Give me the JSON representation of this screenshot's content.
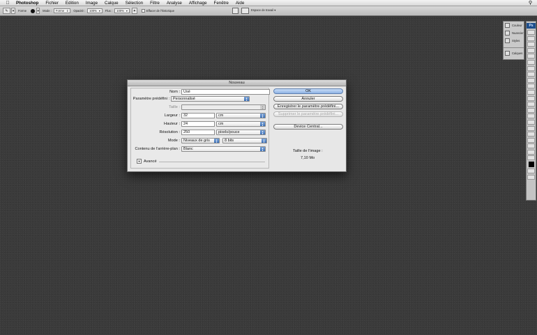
{
  "menubar": {
    "app_name": "Photoshop",
    "items": [
      "Fichier",
      "Edition",
      "Image",
      "Calque",
      "Sélection",
      "Filtre",
      "Analyse",
      "Affichage",
      "Fenêtre",
      "Aide"
    ]
  },
  "options_bar": {
    "forme_label": "Forme",
    "mode_label": "Mode :",
    "mode_value": "Forme",
    "opacity_label": "Opacité :",
    "opacity_value": "100%",
    "flux_label": "Flux :",
    "flux_value": "100%",
    "history_label": "Effacer de l'historique",
    "workspace_label": "Espace de travail"
  },
  "panels": {
    "items": [
      "Couleur",
      "Nuancier",
      "Styles",
      "Calques"
    ]
  },
  "toolbox": {
    "logo": "Ps"
  },
  "dialog": {
    "title": "Nouveau",
    "name_label": "Nom :",
    "name_value": "Usé",
    "preset_label": "Paramètre prédéfini :",
    "preset_value": "Personnalisé",
    "size_label": "Taille :",
    "size_value": "",
    "width_label": "Largeur :",
    "width_value": "32",
    "width_unit": "cm",
    "height_label": "Hauteur :",
    "height_value": "24",
    "height_unit": "cm",
    "resolution_label": "Résolution :",
    "resolution_value": "250",
    "resolution_unit": "pixels/pouce",
    "mode_label": "Mode :",
    "mode_value": "Niveaux de gris",
    "bits_value": "8 bits",
    "background_label": "Contenu de l'arrière-plan :",
    "background_value": "Blanc",
    "advanced_label": "Avancé",
    "ok_label": "OK",
    "cancel_label": "Annuler",
    "save_preset_label": "Enregistrer le paramètre prédéfini...",
    "delete_preset_label": "Supprimer le paramètre prédéfini...",
    "device_central_label": "Device Central...",
    "image_size_label": "Taille de l'image :",
    "image_size_value": "7,10 Mo"
  }
}
